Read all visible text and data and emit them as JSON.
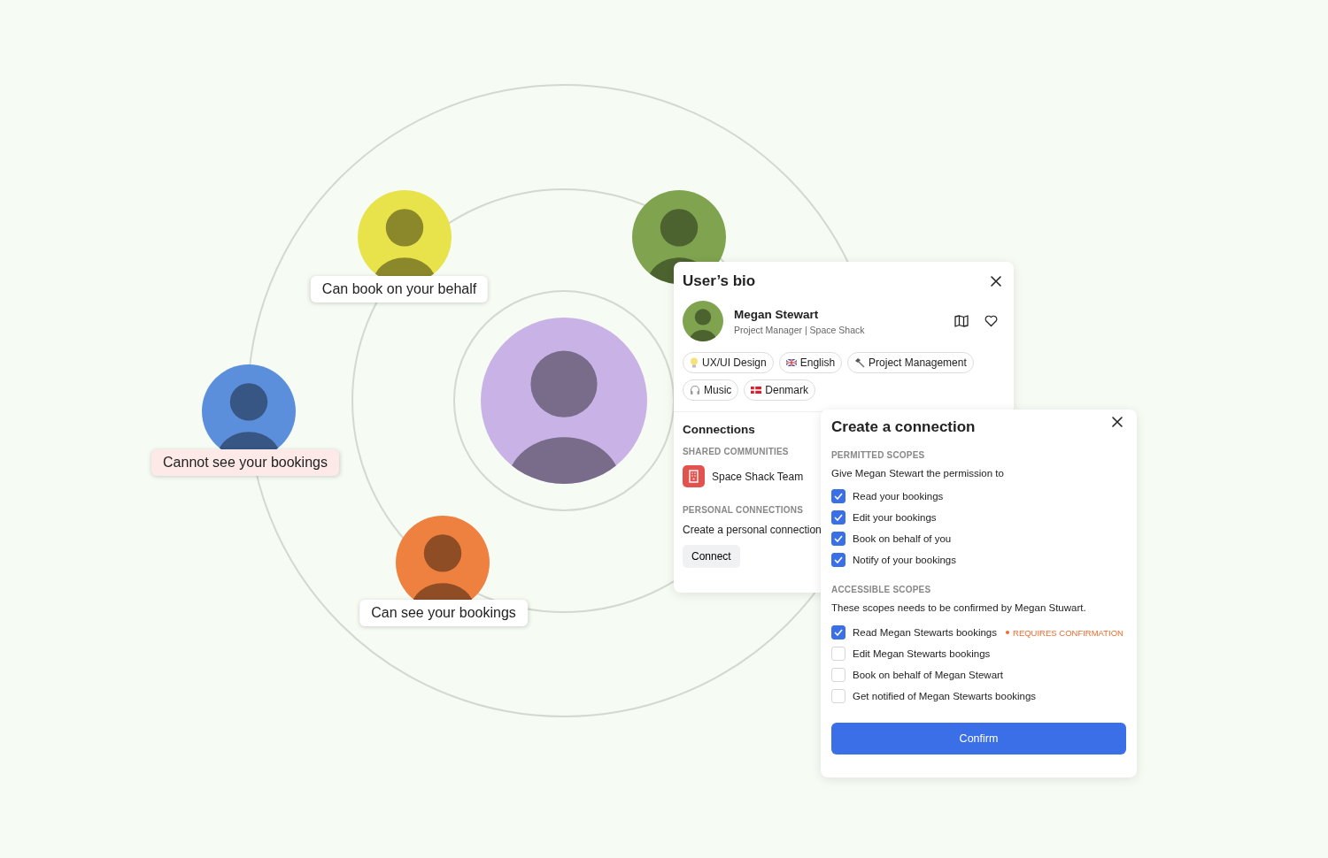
{
  "center_avatar": {
    "color": "#c9b3e6"
  },
  "contacts": [
    {
      "color": "#e8e34a",
      "label": "Can book on your behalf",
      "kind": "allowed"
    },
    {
      "color": "#7fa34f"
    },
    {
      "color": "#5b8fdc",
      "label": "Cannot see your bookings",
      "kind": "denied"
    },
    {
      "color": "#ee8040",
      "label": "Can see your bookings",
      "kind": "allowed"
    }
  ],
  "bio_card": {
    "title": "User’s bio",
    "name": "Megan Stewart",
    "subtitle": "Project Manager | Space Shack",
    "tags": [
      {
        "kind": "bulb",
        "label": "UX/UI Design"
      },
      {
        "kind": "flag-uk",
        "label": "English"
      },
      {
        "kind": "hammer",
        "label": "Project Management"
      },
      {
        "kind": "headphones",
        "label": "Music"
      },
      {
        "kind": "flag-dk",
        "label": "Denmark"
      }
    ],
    "connections_title": "Connections",
    "shared_heading": "SHARED COMMUNITIES",
    "community": "Space Shack Team",
    "personal_heading": "PERSONAL CONNECTIONS",
    "personal_text": "Create a personal connection",
    "connect_button": "Connect"
  },
  "connection_card": {
    "title": "Create a connection",
    "permitted_heading": "PERMITTED SCOPES",
    "permitted_intro": "Give Megan Stewart the permission to",
    "permitted_scopes": [
      {
        "label": "Read your bookings",
        "checked": true
      },
      {
        "label": "Edit your bookings",
        "checked": true
      },
      {
        "label": "Book on behalf of you",
        "checked": true
      },
      {
        "label": "Notify of your bookings",
        "checked": true
      }
    ],
    "accessible_heading": "ACCESSIBLE SCOPES",
    "accessible_intro": "These scopes needs to be confirmed by Megan Stuwart.",
    "accessible_scopes": [
      {
        "label": "Read Megan Stewarts bookings",
        "checked": true,
        "badge": "REQUIRES CONFIRMATION"
      },
      {
        "label": "Edit Megan Stewarts bookings",
        "checked": false
      },
      {
        "label": "Book on behalf of Megan Stewart",
        "checked": false
      },
      {
        "label": "Get notified of Megan Stewarts bookings",
        "checked": false
      }
    ],
    "confirm_button": "Confirm"
  }
}
